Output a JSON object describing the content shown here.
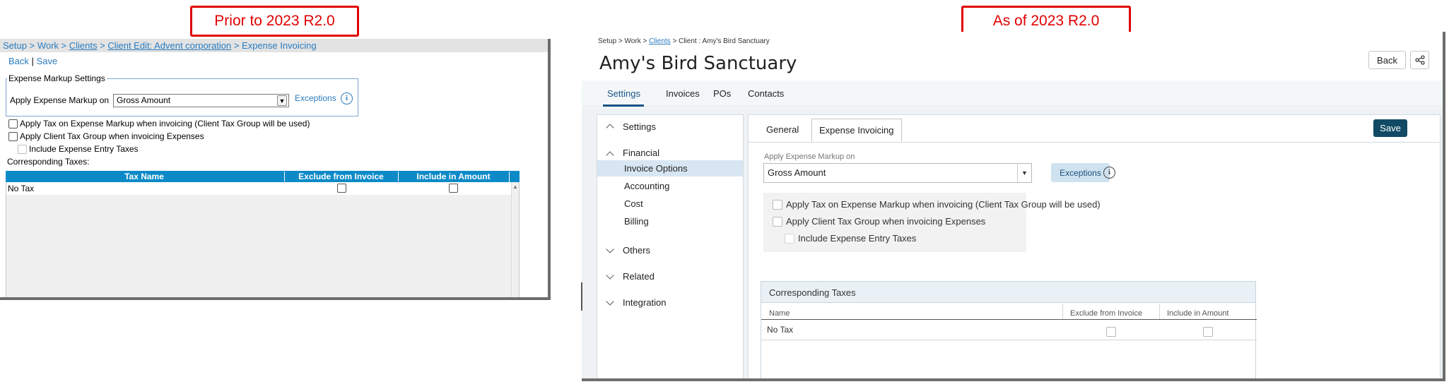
{
  "captions": {
    "before": "Prior to 2023 R2.0",
    "after": "As of 2023 R2.0"
  },
  "old_ui": {
    "breadcrumb": {
      "setup": "Setup",
      "sep1": " > ",
      "work": "Work",
      "sep2": " > ",
      "clients": "Clients",
      "sep3": " > ",
      "client_edit": "Client Edit: Advent corporation",
      "sep4": " > ",
      "current": "Expense Invoicing"
    },
    "actions": {
      "back": "Back",
      "divider": "|",
      "save": "Save"
    },
    "markup_group": {
      "legend": "Expense Markup Settings",
      "label": "Apply Expense Markup on",
      "selected": "Gross Amount",
      "exceptions": "Exceptions"
    },
    "options": {
      "apply_tax": "Apply Tax on Expense Markup when invoicing (Client Tax Group will be used)",
      "apply_client_tax": "Apply Client Tax Group when invoicing Expenses",
      "include_entry_taxes": "Include Expense Entry Taxes"
    },
    "corresponding_label": "Corresponding Taxes:",
    "table": {
      "headers": [
        "Tax Name",
        "Exclude from Invoice",
        "Include in Amount"
      ],
      "rows": [
        {
          "name": "No Tax"
        }
      ]
    }
  },
  "new_ui": {
    "breadcrumb": {
      "setup": "Setup",
      "sep1": " > ",
      "work": "Work",
      "sep2": " > ",
      "clients": "Clients",
      "sep3": " > ",
      "current": "Client : Amy's Bird Sanctuary"
    },
    "title": "Amy's Bird Sanctuary",
    "back": "Back",
    "tabs": [
      "Settings",
      "Invoices",
      "POs",
      "Contacts"
    ],
    "nav": {
      "settings": "Settings",
      "financial": "Financial",
      "financial_items": [
        "Invoice Options",
        "Accounting",
        "Cost",
        "Billing"
      ],
      "others": "Others",
      "related": "Related",
      "integration": "Integration"
    },
    "panel_tabs": {
      "general": "General",
      "expense": "Expense Invoicing"
    },
    "save": "Save",
    "markup_label": "Apply Expense Markup on",
    "markup_value": "Gross Amount",
    "exceptions": "Exceptions",
    "options": {
      "apply_tax": "Apply Tax on Expense Markup when invoicing (Client Tax Group will be used)",
      "apply_client_tax": "Apply Client Tax Group when invoicing Expenses",
      "include_entry_taxes": "Include Expense Entry Taxes"
    },
    "corresponding": {
      "title": "Corresponding Taxes",
      "headers": [
        "Name",
        "Exclude from Invoice",
        "Include in Amount"
      ],
      "rows": [
        {
          "name": "No Tax"
        }
      ]
    }
  }
}
